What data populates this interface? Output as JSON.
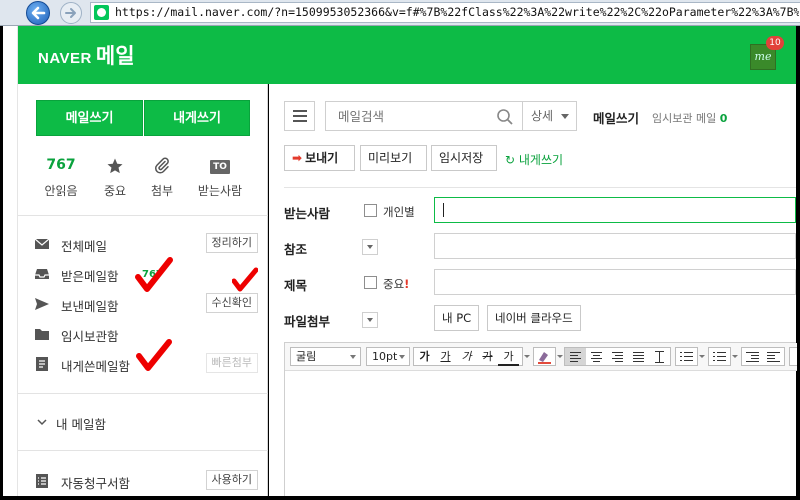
{
  "browser": {
    "url": "https://mail.naver.com/?n=1509953052366&v=f#%7B%22fClass%22%3A%22write%22%2C%22oParameter%22%3A%7B%22ord"
  },
  "header": {
    "logo_brand": "NAVER",
    "logo_service": "메일",
    "me_label": "me",
    "me_badge": "10",
    "bg_color": "#0dbb46"
  },
  "sidebar": {
    "write_button": "메일쓰기",
    "self_write_button": "내게쓰기",
    "quick": [
      {
        "top": "767",
        "label": "안읽음"
      },
      {
        "icon": "star-icon",
        "label": "중요"
      },
      {
        "icon": "paperclip-icon",
        "label": "첨부"
      },
      {
        "top": "TO",
        "label": "받는사람"
      }
    ],
    "folders": [
      {
        "label": "전체메일",
        "icon": "envelope-icon",
        "action": "정리하기"
      },
      {
        "label": "받은메일함",
        "icon": "inbox-icon",
        "count": "767"
      },
      {
        "label": "보낸메일함",
        "icon": "send-icon",
        "action": "수신확인"
      },
      {
        "label": "임시보관함",
        "icon": "folder-icon"
      },
      {
        "label": "내게쓴메일함",
        "icon": "document-icon",
        "action": "빠른첨부"
      }
    ],
    "my_mailbox": "내 메일함",
    "auto_billing": {
      "label": "자동청구서함",
      "action": "사용하기"
    }
  },
  "main": {
    "search_placeholder": "메일검색",
    "detail_search": "상세",
    "title": "메일쓰기",
    "temp_saved_label": "임시보관 메일",
    "temp_saved_count": "0",
    "send": "보내기",
    "preview": "미리보기",
    "save_temp": "임시저장",
    "self_write": "내게쓰기",
    "recipient_label": "받는사람",
    "individual_label": "개인별",
    "cc_label": "참조",
    "subject_label": "제목",
    "important_label": "중요",
    "important_mark": "!",
    "attach_label": "파일첨부",
    "my_pc": "내 PC",
    "naver_cloud": "네이버 클라우드"
  },
  "editor": {
    "font": "굴림",
    "size": "10pt",
    "style_buttons": [
      "가",
      "가",
      "가",
      "가",
      "가"
    ]
  }
}
